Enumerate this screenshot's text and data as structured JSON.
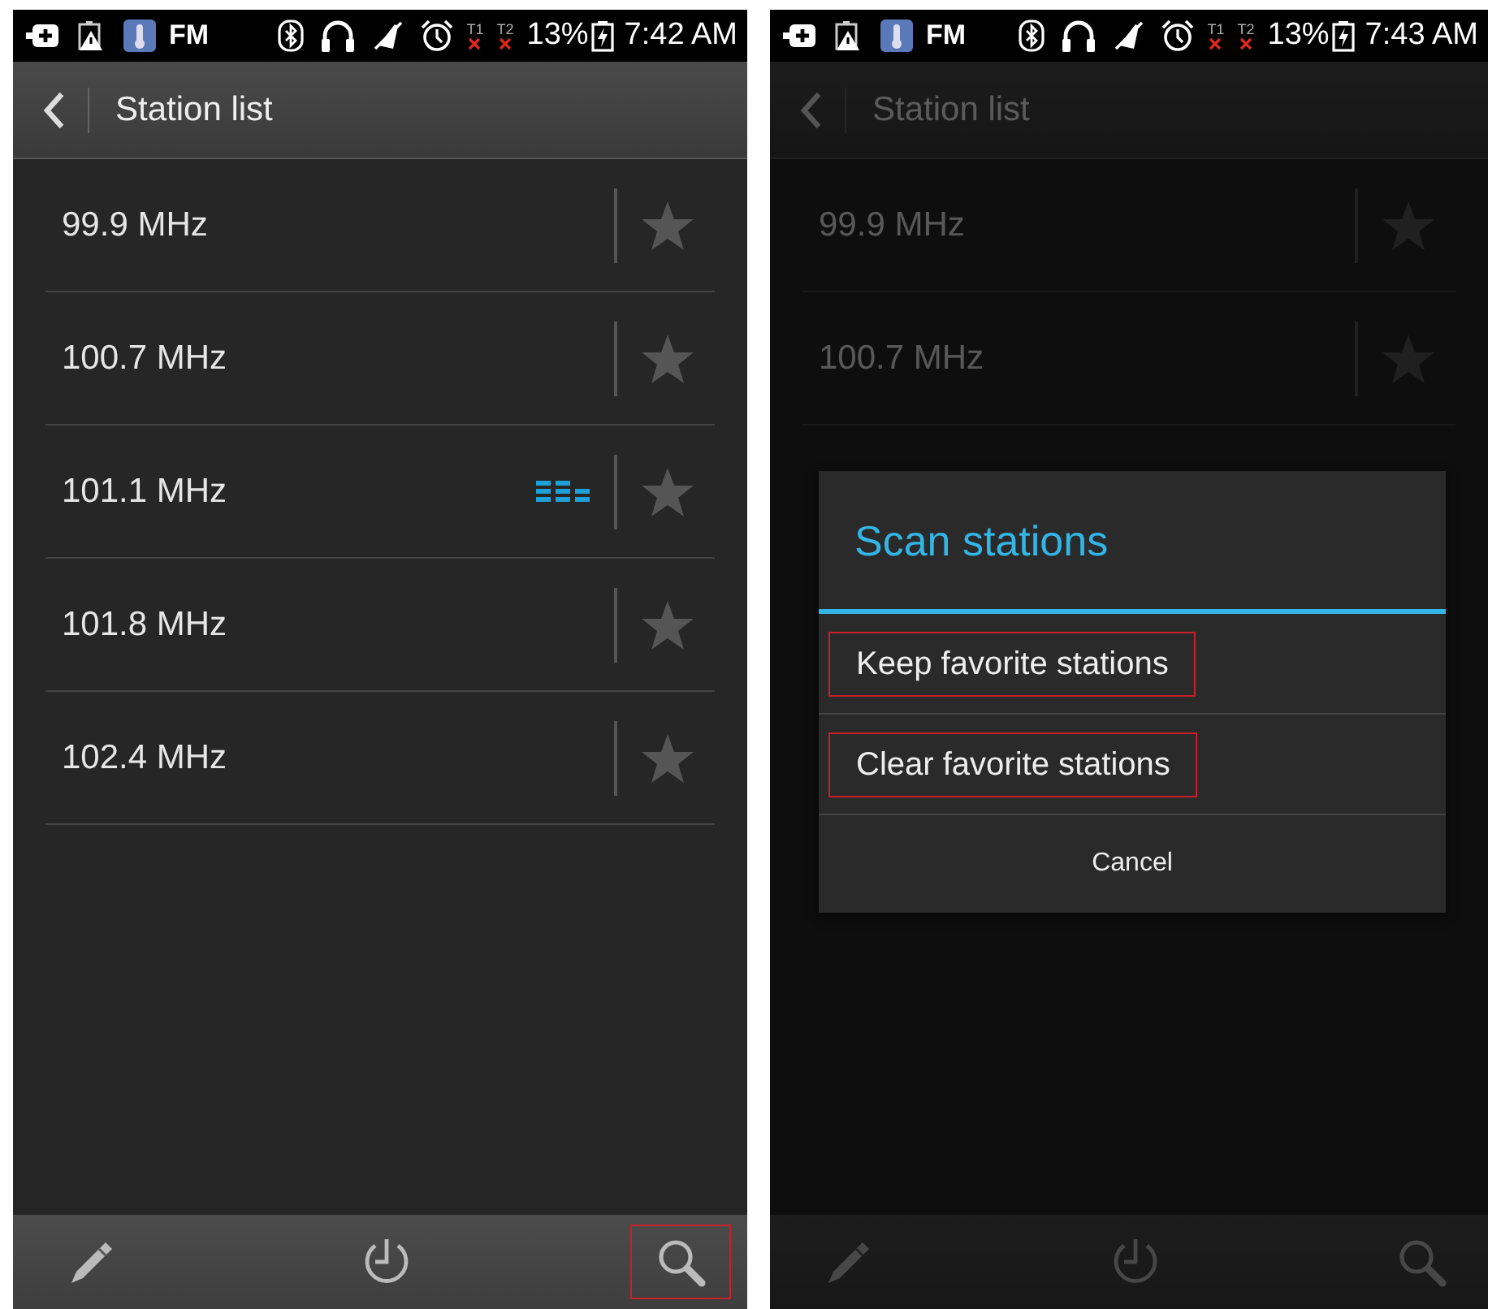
{
  "screens": [
    {
      "status_bar": {
        "app_label": "FM",
        "sims": [
          {
            "label": "T1"
          },
          {
            "label": "T2"
          }
        ],
        "battery": "13%",
        "time": "7:42 AM"
      },
      "action_bar": {
        "title": "Station list"
      },
      "stations": [
        {
          "frequency": "99.9 MHz",
          "playing": false
        },
        {
          "frequency": "100.7 MHz",
          "playing": false
        },
        {
          "frequency": "101.1 MHz",
          "playing": true
        },
        {
          "frequency": "101.8 MHz",
          "playing": false
        },
        {
          "frequency": "102.4 MHz",
          "playing": false
        }
      ],
      "toolbar": [
        {
          "kind": "edit",
          "highlighted": false
        },
        {
          "kind": "timer",
          "highlighted": false
        },
        {
          "kind": "search",
          "highlighted": true
        }
      ]
    },
    {
      "status_bar": {
        "app_label": "FM",
        "sims": [
          {
            "label": "T1"
          },
          {
            "label": "T2"
          }
        ],
        "battery": "13%",
        "time": "7:43 AM"
      },
      "action_bar": {
        "title": "Station list"
      },
      "stations": [
        {
          "frequency": "99.9 MHz",
          "playing": false
        },
        {
          "frequency": "100.7 MHz",
          "playing": false
        }
      ],
      "toolbar": [
        {
          "kind": "edit",
          "highlighted": false
        },
        {
          "kind": "timer",
          "highlighted": false
        },
        {
          "kind": "search",
          "highlighted": false
        }
      ],
      "dialog": {
        "title": "Scan stations",
        "options": [
          {
            "label": "Keep favorite stations",
            "highlighted": true
          },
          {
            "label": "Clear favorite stations",
            "highlighted": true
          }
        ],
        "cancel": "Cancel"
      }
    }
  ]
}
